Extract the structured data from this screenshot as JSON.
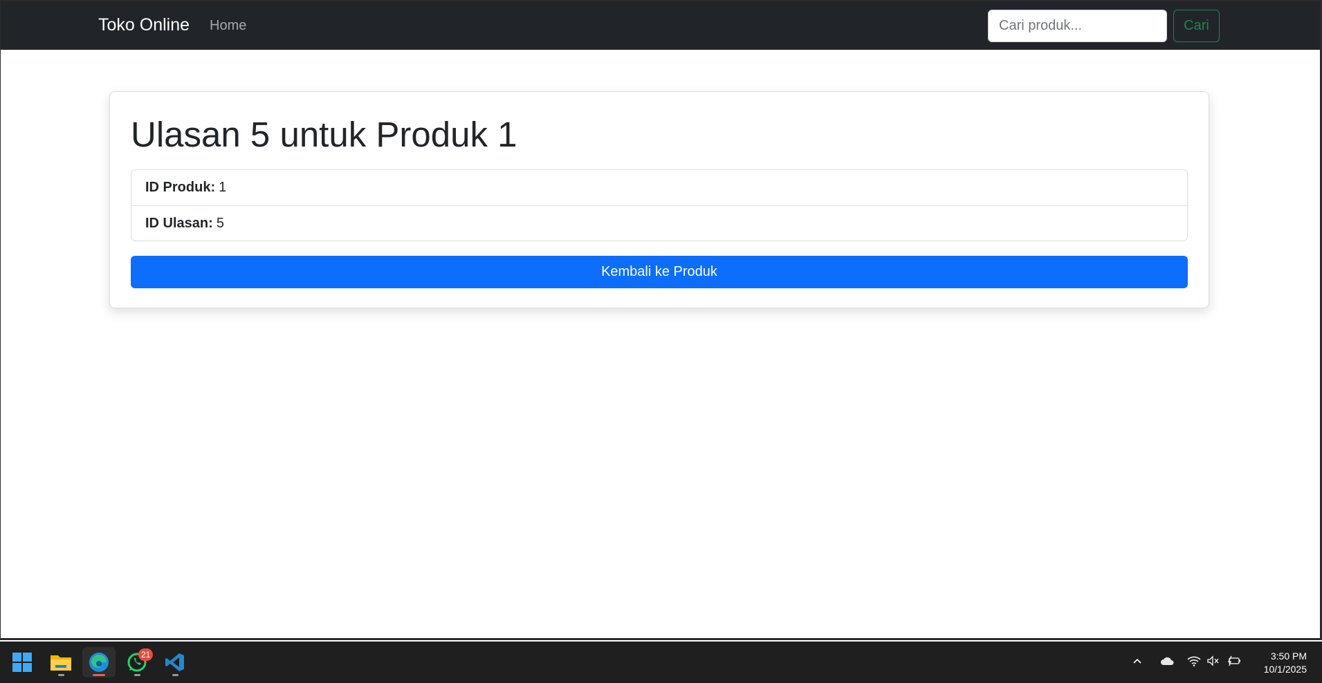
{
  "navbar": {
    "brand": "Toko Online",
    "home_label": "Home",
    "search_placeholder": "Cari produk...",
    "search_button": "Cari"
  },
  "review": {
    "title": "Ulasan 5 untuk Produk 1",
    "product_id_label": "ID Produk:",
    "product_id_value": "1",
    "review_id_label": "ID Ulasan:",
    "review_id_value": "5",
    "back_button": "Kembali ke Produk"
  },
  "taskbar": {
    "apps": [
      {
        "name": "windows-start-icon"
      },
      {
        "name": "file-explorer-icon"
      },
      {
        "name": "edge-browser-icon"
      },
      {
        "name": "whatsapp-icon",
        "badge": "21"
      },
      {
        "name": "vscode-icon"
      }
    ],
    "time": "3:50 PM",
    "date": "10/1/2025"
  },
  "colors": {
    "navbar_bg": "#212529",
    "primary": "#0d6efd",
    "success": "#198754"
  }
}
